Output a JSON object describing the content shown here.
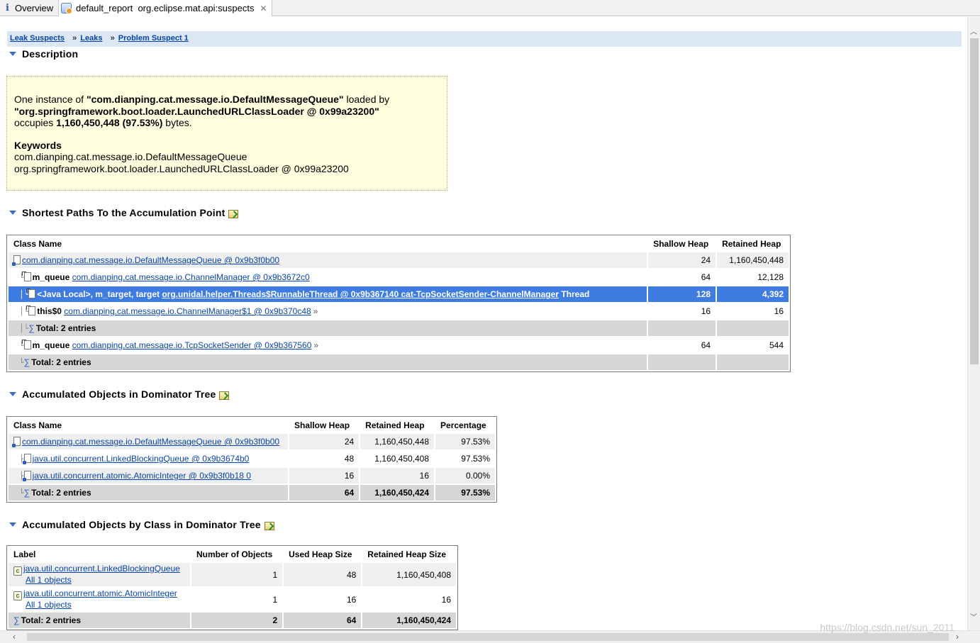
{
  "tabs": {
    "overview": "Overview",
    "report_title": "default_report  org.eclipse.mat.api:suspects"
  },
  "breadcrumb": {
    "items": [
      "Leak Suspects",
      "Leaks",
      "Problem Suspect 1"
    ],
    "separator": "»"
  },
  "description": {
    "heading": "Description",
    "line1_prefix": "One instance of ",
    "line1_class": "\"com.dianping.cat.message.io.DefaultMessageQueue\"",
    "line1_suffix": " loaded by",
    "line2_loader": "\"org.springframework.boot.loader.LaunchedURLClassLoader @ 0x99a23200\"",
    "line3_prefix": "occupies ",
    "line3_size": "1,160,450,448 (97.53%)",
    "line3_suffix": " bytes.",
    "keywords_title": "Keywords",
    "keywords": [
      "com.dianping.cat.message.io.DefaultMessageQueue",
      "org.springframework.boot.loader.LaunchedURLClassLoader @ 0x99a23200"
    ]
  },
  "shortest_paths": {
    "heading": "Shortest Paths To the Accumulation Point",
    "columns": [
      "Class Name",
      "Shallow Heap",
      "Retained Heap"
    ],
    "rows": [
      {
        "field": "",
        "link": "com.dianping.cat.message.io.DefaultMessageQueue @ 0x9b3f0b00",
        "after": "",
        "shallow": "24",
        "retained": "1,160,450,448"
      },
      {
        "field": "m_queue ",
        "link": "com.dianping.cat.message.io.ChannelManager @ 0x9b3672c0",
        "after": "",
        "shallow": "64",
        "retained": "12,128"
      },
      {
        "field": "<Java Local>, m_target, target ",
        "link": "org.unidal.helper.Threads$RunnableThread @ 0x9b367140 cat-TcpSocketSender-ChannelManager",
        "after": " Thread",
        "shallow": "128",
        "retained": "4,392"
      },
      {
        "field": "this$0 ",
        "link": "com.dianping.cat.message.io.ChannelManager$1 @ 0x9b370c48",
        "after": "»",
        "shallow": "16",
        "retained": "16"
      },
      {
        "field": "Total: 2 entries",
        "link": "",
        "after": "",
        "shallow": "",
        "retained": ""
      },
      {
        "field": "m_queue ",
        "link": "com.dianping.cat.message.io.TcpSocketSender @ 0x9b367560",
        "after": "»",
        "shallow": "64",
        "retained": "544"
      },
      {
        "field": "Total: 2 entries",
        "link": "",
        "after": "",
        "shallow": "",
        "retained": ""
      }
    ]
  },
  "dominator": {
    "heading": "Accumulated Objects in Dominator Tree",
    "columns": [
      "Class Name",
      "Shallow Heap",
      "Retained Heap",
      "Percentage"
    ],
    "rows": [
      {
        "name": "com.dianping.cat.message.io.DefaultMessageQueue @ 0x9b3f0b00",
        "shallow": "24",
        "retained": "1,160,450,448",
        "pct": "97.53%"
      },
      {
        "name": "java.util.concurrent.LinkedBlockingQueue @ 0x9b3674b0",
        "shallow": "48",
        "retained": "1,160,450,408",
        "pct": "97.53%"
      },
      {
        "name": "java.util.concurrent.atomic.AtomicInteger @ 0x9b3f0b18 0",
        "shallow": "16",
        "retained": "16",
        "pct": "0.00%"
      }
    ],
    "total": {
      "label": "Total: 2 entries",
      "shallow": "64",
      "retained": "1,160,450,424",
      "pct": "97.53%"
    }
  },
  "by_class": {
    "heading": "Accumulated Objects by Class in Dominator Tree",
    "columns": [
      "Label",
      "Number of Objects",
      "Used Heap Size",
      "Retained Heap Size"
    ],
    "rows": [
      {
        "label": "java.util.concurrent.LinkedBlockingQueue",
        "sub": "All 1 objects",
        "count": "1",
        "used": "48",
        "retained": "1,160,450,408"
      },
      {
        "label": "java.util.concurrent.atomic.AtomicInteger",
        "sub": "All 1 objects",
        "count": "1",
        "used": "16",
        "retained": "16"
      }
    ],
    "total": {
      "label": "Total: 2 entries",
      "count": "2",
      "used": "64",
      "retained": "1,160,450,424"
    }
  },
  "watermark": "https://blog.csdn.net/sun_2011"
}
